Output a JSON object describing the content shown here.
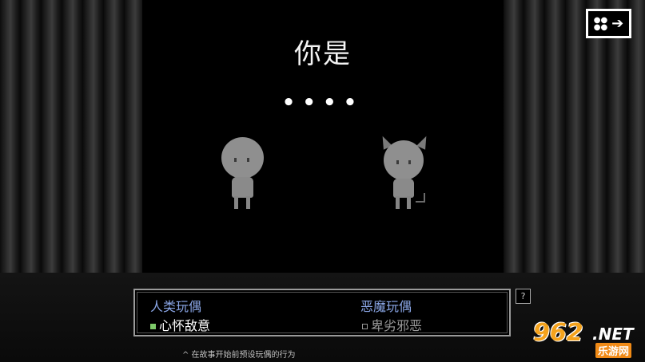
{
  "title": "你是",
  "dots": "••••",
  "characters": [
    {
      "name": "human-doll"
    },
    {
      "name": "demon-doll"
    }
  ],
  "choices": {
    "human": {
      "title": "人类玩偶",
      "value": "心怀敌意",
      "selected": true
    },
    "demon": {
      "title": "恶魔玩偶",
      "value": "卑劣邪恶",
      "selected": false
    }
  },
  "help_label": "?",
  "footnote": "^ 在故事开始前预设玩偶的行为",
  "watermark": {
    "brand": "962",
    "suffix": ".NET",
    "sub": "乐游网"
  },
  "colors": {
    "option_title": "#8aa6e6",
    "selected_box": "#7ecb6a",
    "watermark": "#f4a21c"
  }
}
